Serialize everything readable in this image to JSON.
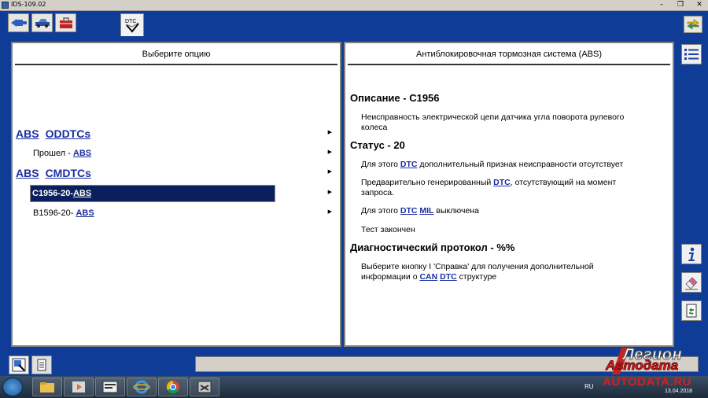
{
  "window": {
    "title": "IDS-109.02",
    "controls": [
      "–",
      "❐",
      "✕"
    ]
  },
  "toolbar": {
    "tabs": [
      {
        "icon": "connector-icon"
      },
      {
        "icon": "vehicle-icon"
      },
      {
        "icon": "toolbox-icon"
      },
      {
        "icon": "dtc-icon",
        "label": "DTC"
      }
    ],
    "exit_icon": "exit-arrows-icon"
  },
  "left_panel": {
    "header": "Выберите опцию",
    "groups": [
      {
        "title_a": "ABS",
        "title_b": "ODDTCs",
        "items": [
          {
            "prefix": "Прошел - ",
            "link": "ABS",
            "selected": false
          }
        ]
      },
      {
        "title_a": "ABS",
        "title_b": "CMDTCs",
        "items": [
          {
            "prefix": "C1956-20- ",
            "link": "ABS",
            "selected": true
          },
          {
            "prefix": "B1596-20- ",
            "link": "ABS",
            "selected": false
          }
        ]
      }
    ],
    "arrow": "▶"
  },
  "right_panel": {
    "header": "Антиблокировочная тормозная система (ABS)",
    "desc_title": "Описание - C1956",
    "desc_text_1": "Неисправность электрической цепи датчика угла поворота рулевого",
    "desc_text_2": "колеса",
    "status_title": "Статус - 20",
    "status_1_a": "Для этого ",
    "status_1_link": "DTC",
    "status_1_b": " дополнительный признак неисправности отсутствует",
    "status_2_a": "Предварительно генерированный ",
    "status_2_link": "DTC",
    "status_2_b": ", отсутствующий на момент",
    "status_2_c": "запроса.",
    "status_3_a": "Для этого ",
    "status_3_link1": "DTC",
    "status_3_link2": "MIL",
    "status_3_b": " выключена",
    "status_4": "Тест закончен",
    "protocol_title": "Диагностический протокол - %%",
    "protocol_1": "Выберите кнопку I 'Справка' для получения дополнительной",
    "protocol_2_a": "информации о ",
    "protocol_2_link1": "CAN",
    "protocol_2_link2": "DTC",
    "protocol_2_b": " структуре"
  },
  "side_buttons": [
    "list-icon",
    "info-icon",
    "eraser-icon",
    "report-icon"
  ],
  "statusbar": {
    "buttons": [
      "screen-capture-icon",
      "notes-icon"
    ]
  },
  "taskbar": {
    "apps": [
      "file-explorer-icon",
      "media-player-icon",
      "ids-app-icon",
      "internet-explorer-icon",
      "chrome-icon",
      "diagnostic-tool-icon"
    ],
    "lang": "RU",
    "date": "13.04.2018"
  },
  "watermark": {
    "line1": "Легион",
    "line2": "Автодата",
    "line3": "AUTODATA.RU"
  },
  "colors": {
    "frame": "#0f3c96",
    "link": "#1a2fa0",
    "selected_bg": "#0a1f5c"
  }
}
